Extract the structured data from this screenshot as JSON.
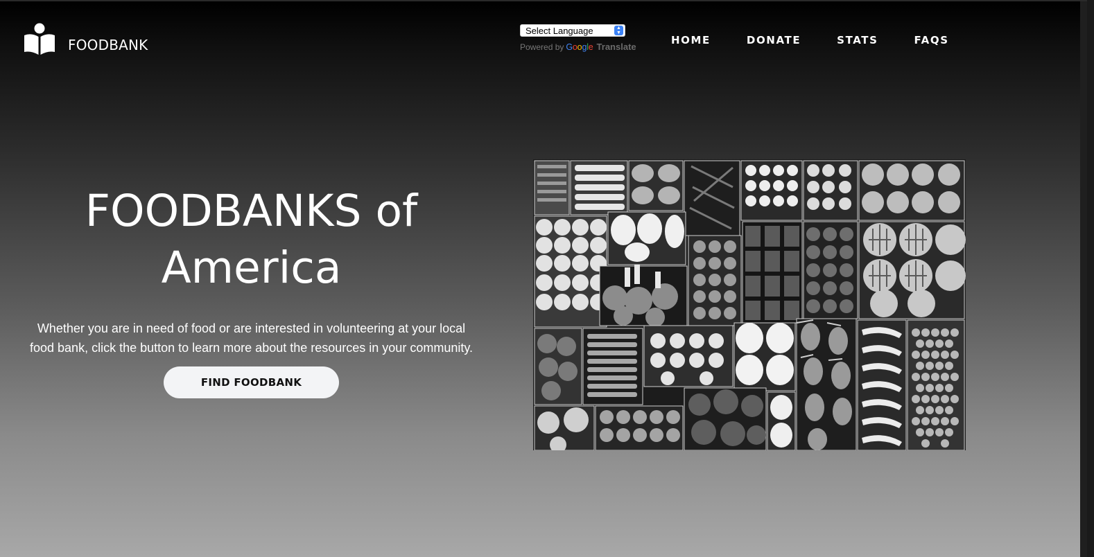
{
  "brand": {
    "logo_icon": "reader-book-icon",
    "name": "FOODBANK"
  },
  "translate": {
    "select_value": "Select Language",
    "powered_by": "Powered by",
    "google_word": [
      "G",
      "o",
      "o",
      "g",
      "l",
      "e"
    ],
    "translate_word": "Translate"
  },
  "nav": {
    "items": [
      {
        "label": "HOME"
      },
      {
        "label": "DONATE"
      },
      {
        "label": "STATS"
      },
      {
        "label": "FAQS"
      }
    ]
  },
  "hero": {
    "title_line1": "FOODBANKS of",
    "title_line2": "America",
    "description_line1": "Whether you are in need of food or are interested in volunteering at your local",
    "description_line2": "food bank, click the button to learn more about the resources in your community.",
    "button_label": "FIND FOODBANK",
    "image_subject": "produce-market-photo"
  },
  "colors": {
    "text_primary": "#ffffff",
    "button_bg": "#f3f4f6",
    "button_text": "#111111",
    "select_arrow": "#3b82f6",
    "google_blue": "#4285f4",
    "google_red": "#ea4335",
    "google_yellow": "#fbbc05",
    "google_green": "#34a853"
  }
}
